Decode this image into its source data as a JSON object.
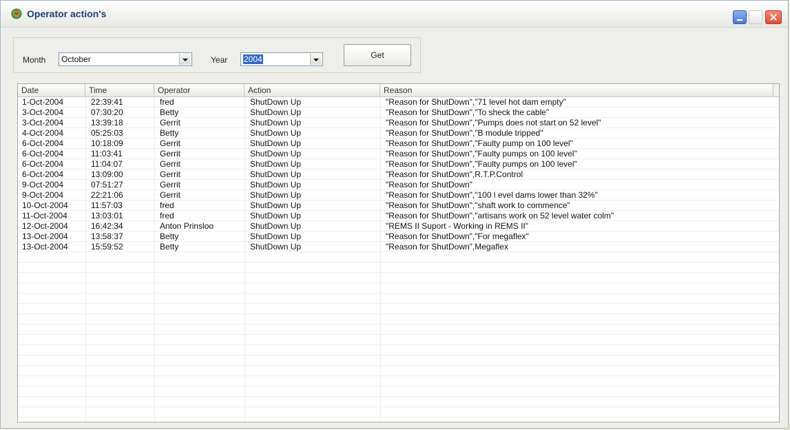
{
  "window": {
    "title": "Operator action's",
    "icon": "app-icon"
  },
  "filters": {
    "month_label": "Month",
    "month_value": "October",
    "year_label": "Year",
    "year_value": "2004",
    "get_label": "Get"
  },
  "table": {
    "columns": [
      "Date",
      "Time",
      "Operator",
      "Action",
      "Reason"
    ],
    "rows": [
      [
        "1-Oct-2004",
        "22:39:41",
        "fred",
        "ShutDown Up",
        "\"Reason for ShutDown\",\"71 level hot dam empty\""
      ],
      [
        "3-Oct-2004",
        "07:30:20",
        "Betty",
        "ShutDown Up",
        "\"Reason for ShutDown\",\"To sheck the cable\""
      ],
      [
        "3-Oct-2004",
        "13:39:18",
        "Gerrit",
        "ShutDown Up",
        "\"Reason for ShutDown\",\"Pumps does not start on 52 level\""
      ],
      [
        "4-Oct-2004",
        "05:25:03",
        "Betty",
        "ShutDown Up",
        "\"Reason for ShutDown\",\"B module tripped\""
      ],
      [
        "6-Oct-2004",
        "10:18:09",
        "Gerrit",
        "ShutDown Up",
        "\"Reason for ShutDown\",\"Faulty pump on 100 level\""
      ],
      [
        "6-Oct-2004",
        "11:03:41",
        "Gerrit",
        "ShutDown Up",
        "\"Reason for ShutDown\",\"Faulty pumps on 100 level\""
      ],
      [
        "6-Oct-2004",
        "11:04:07",
        "Gerrit",
        "ShutDown Up",
        "\"Reason for ShutDown\",\"Faulty pumps on 100 level\""
      ],
      [
        "6-Oct-2004",
        "13:09:00",
        "Gerrit",
        "ShutDown Up",
        "\"Reason for ShutDown\",R.T.P.Control"
      ],
      [
        "9-Oct-2004",
        "07:51:27",
        "Gerrit",
        "ShutDown Up",
        "\"Reason for ShutDown\""
      ],
      [
        "9-Oct-2004",
        "22:21:06",
        "Gerrit",
        "ShutDown Up",
        "\"Reason for ShutDown\",\"100 l evel dams lower than 32%\""
      ],
      [
        "10-Oct-2004",
        "11:57:03",
        "fred",
        "ShutDown Up",
        "\"Reason for ShutDown\",\"shaft work to commence\""
      ],
      [
        "11-Oct-2004",
        "13:03:01",
        "fred",
        "ShutDown Up",
        "\"Reason for ShutDown\",\"artisans work on 52 level water colm\""
      ],
      [
        "12-Oct-2004",
        "16:42:34",
        "Anton Prinsloo",
        "ShutDown Up",
        "\"REMS II Suport - Working in REMS II\""
      ],
      [
        "13-Oct-2004",
        "13:58:37",
        "Betty",
        "ShutDown Up",
        "\"Reason for ShutDown\",\"For megaflex\""
      ],
      [
        "13-Oct-2004",
        "15:59:52",
        "Betty",
        "ShutDown Up",
        "\"Reason for ShutDown\",Megaflex"
      ]
    ]
  }
}
